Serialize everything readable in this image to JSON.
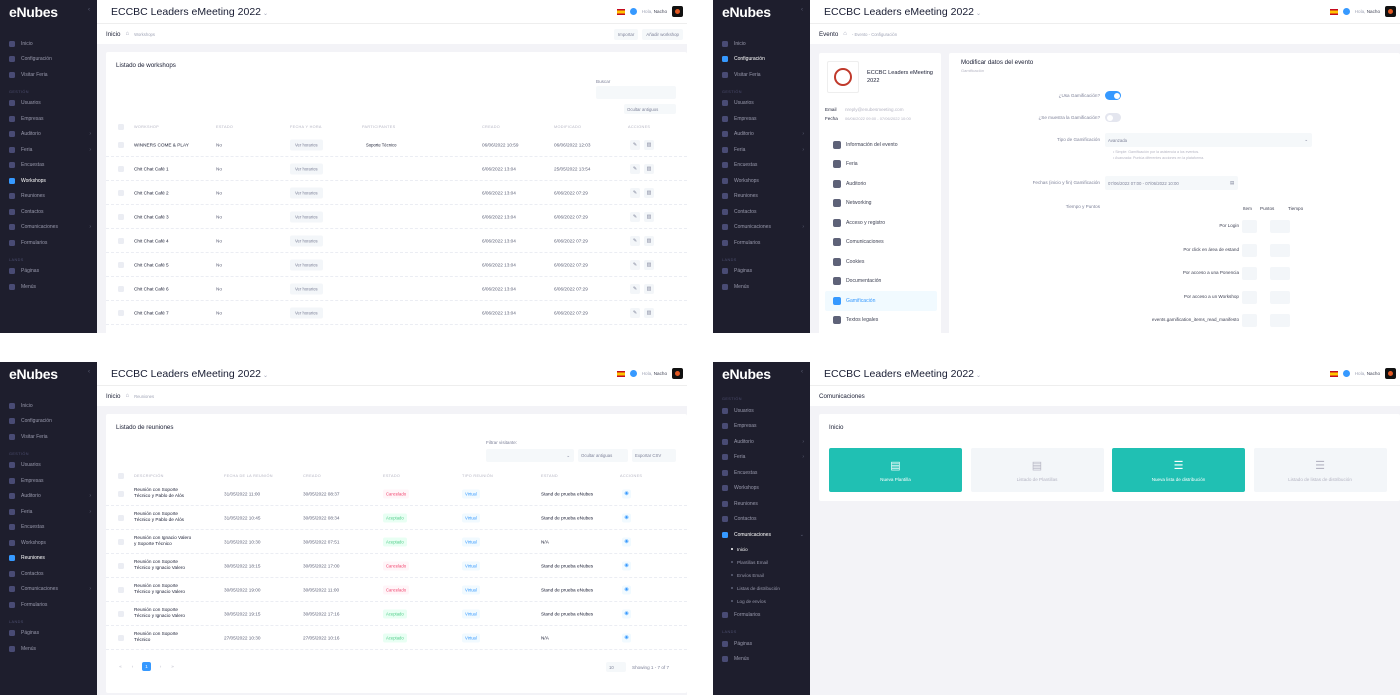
{
  "app": {
    "logo": "eNubes",
    "event_title": "ECCBC Leaders eMeeting 2022",
    "greeting": "Hola,",
    "user": "Nacho"
  },
  "colors": {
    "sidebar": "#1e1e2d",
    "accent": "#3699ff",
    "teal": "#20c0b3",
    "danger": "#f1416c",
    "success": "#50cd89"
  },
  "panel1": {
    "sidebar": [
      {
        "label": "Inicio",
        "section": ""
      },
      {
        "label": "Configuración",
        "section": ""
      },
      {
        "label": "Visitar Feria",
        "section": ""
      },
      {
        "label": "Usuarios",
        "section": "GESTIÓN"
      },
      {
        "label": "Empresas",
        "section": ""
      },
      {
        "label": "Auditorio",
        "section": "",
        "arrow": true
      },
      {
        "label": "Feria",
        "section": "",
        "arrow": true
      },
      {
        "label": "Encuestas",
        "section": ""
      },
      {
        "label": "Workshops",
        "section": "",
        "active": true
      },
      {
        "label": "Reuniones",
        "section": ""
      },
      {
        "label": "Contactos",
        "section": ""
      },
      {
        "label": "Comunicaciones",
        "section": "",
        "arrow": true
      },
      {
        "label": "Formularios",
        "section": ""
      },
      {
        "label": "Páginas",
        "section": "LANDS"
      },
      {
        "label": "Menús",
        "section": ""
      }
    ],
    "page_title": "Inicio",
    "breadcrumb": "Workshops",
    "btn_import": "Importar",
    "btn_add": "Añadir workshop",
    "card_title": "Listado de workshops",
    "search_label": "Buscar",
    "hide_old": "Ocultar antiguos",
    "headers": [
      "WORKSHOP",
      "ESTADO",
      "FECHA Y HORA",
      "PARTICIPANTES",
      "CREADO",
      "MODIFICADO",
      "ACCIONES"
    ],
    "view_schedule": "Ver horarios",
    "rows": [
      {
        "name": "WINNERS COME & PLAY",
        "status": "No",
        "participants": "Soporte Técnico",
        "created": "06/06/2022 10:59",
        "modified": "06/06/2022 12:03"
      },
      {
        "name": "Chit Chat Café 1",
        "status": "No",
        "participants": "",
        "created": "6/06/2022 13:04",
        "modified": "25/05/2022 13:54"
      },
      {
        "name": "Chit Chat Café 2",
        "status": "No",
        "participants": "",
        "created": "6/06/2022 13:04",
        "modified": "6/06/2022 07:29"
      },
      {
        "name": "Chit Chat Café 3",
        "status": "No",
        "participants": "",
        "created": "6/06/2022 13:04",
        "modified": "6/06/2022 07:29"
      },
      {
        "name": "Chit Chat Café 4",
        "status": "No",
        "participants": "",
        "created": "6/06/2022 13:04",
        "modified": "6/06/2022 07:29"
      },
      {
        "name": "Chit Chat Café 5",
        "status": "No",
        "participants": "",
        "created": "6/06/2022 13:04",
        "modified": "6/06/2022 07:29"
      },
      {
        "name": "Chit Chat Café 6",
        "status": "No",
        "participants": "",
        "created": "6/06/2022 13:04",
        "modified": "6/06/2022 07:29"
      },
      {
        "name": "Chit Chat Café 7",
        "status": "No",
        "participants": "",
        "created": "6/06/2022 13:04",
        "modified": "6/06/2022 07:29"
      }
    ]
  },
  "panel2": {
    "sidebar": [
      {
        "label": "Inicio",
        "section": ""
      },
      {
        "label": "Configuración",
        "section": "",
        "active": true
      },
      {
        "label": "Visitar Feria",
        "section": ""
      },
      {
        "label": "Usuarios",
        "section": "GESTIÓN"
      },
      {
        "label": "Empresas",
        "section": ""
      },
      {
        "label": "Auditorio",
        "section": "",
        "arrow": true
      },
      {
        "label": "Feria",
        "section": "",
        "arrow": true
      },
      {
        "label": "Encuestas",
        "section": ""
      },
      {
        "label": "Workshops",
        "section": ""
      },
      {
        "label": "Reuniones",
        "section": ""
      },
      {
        "label": "Contactos",
        "section": ""
      },
      {
        "label": "Comunicaciones",
        "section": "",
        "arrow": true
      },
      {
        "label": "Formularios",
        "section": ""
      },
      {
        "label": "Páginas",
        "section": "LANDS"
      },
      {
        "label": "Menús",
        "section": ""
      }
    ],
    "page_title": "Evento",
    "breadcrumb": "- Evento - Configuración",
    "event_name": "ECCBC Leaders eMeeting 2022",
    "email_label": "Email",
    "email_value": "nreply@enubesmeeting.com",
    "date_label": "Fecha",
    "date_value": "06/06/2022 09:00 - 07/06/2022 10:00",
    "nav": [
      {
        "label": "Información del evento"
      },
      {
        "label": "Feria"
      },
      {
        "label": "Auditorio"
      },
      {
        "label": "Networking"
      },
      {
        "label": "Acceso y registro"
      },
      {
        "label": "Comunicaciones"
      },
      {
        "label": "Cookies"
      },
      {
        "label": "Documentación"
      },
      {
        "label": "Gamificación",
        "active": true
      },
      {
        "label": "Textos legales"
      }
    ],
    "form_title": "Modificar datos del evento",
    "form_subtitle": "Gamificación",
    "q_use": "¿Usa Gamificación?",
    "q_show": "¿Se muestra la Gamificación?",
    "type_label": "Tipo de Gamificación",
    "type_value": "Avanzada",
    "type_help1": "• Simple: Gamificación por la asistencia a los eventos.",
    "type_help2": "• Avanzada: Puntúa diferentes acciones en la plataforma.",
    "dates_label": "Fechas (inicio y fin) Gamificación",
    "dates_value": "07/06/2022 07:00 - 07/06/2022 10:00",
    "tp_label": "Tiempo y Puntos",
    "col_item": "Item",
    "col_points": "Puntos",
    "col_time": "Tiempo",
    "items": [
      "Por Login",
      "Por click en área de estand",
      "Por acceso a una Ponencia",
      "Por acceso a un Workshop",
      "events.gamification_items_read_manifesto"
    ]
  },
  "panel3": {
    "sidebar": [
      {
        "label": "Inicio",
        "section": ""
      },
      {
        "label": "Configuración",
        "section": ""
      },
      {
        "label": "Visitar Feria",
        "section": ""
      },
      {
        "label": "Usuarios",
        "section": "GESTIÓN"
      },
      {
        "label": "Empresas",
        "section": ""
      },
      {
        "label": "Auditorio",
        "section": "",
        "arrow": true
      },
      {
        "label": "Feria",
        "section": "",
        "arrow": true
      },
      {
        "label": "Encuestas",
        "section": ""
      },
      {
        "label": "Workshops",
        "section": ""
      },
      {
        "label": "Reuniones",
        "section": "",
        "active": true
      },
      {
        "label": "Contactos",
        "section": ""
      },
      {
        "label": "Comunicaciones",
        "section": "",
        "arrow": true
      },
      {
        "label": "Formularios",
        "section": ""
      },
      {
        "label": "Páginas",
        "section": "LANDS"
      },
      {
        "label": "Menús",
        "section": ""
      }
    ],
    "page_title": "Inicio",
    "breadcrumb": "Reuniones",
    "card_title": "Listado de reuniones",
    "filter_label": "Filtrar visitante:",
    "hide_old": "Ocultar antiguas",
    "export": "Exportar CSV",
    "headers": [
      "DESCRIPCIÓN",
      "FECHA DE LA REUNIÓN",
      "CREADO",
      "ESTADO",
      "TIPO REUNIÓN",
      "ESTAND",
      "ACCIONES"
    ],
    "rows": [
      {
        "l1": "Reunión con Soporte",
        "l2": "Técnico y Pablo de Alós",
        "date": "31/05/2022 11:00",
        "created": "30/05/2022 08:37",
        "status": "Cancelado",
        "sc": "red",
        "type": "Virtual",
        "stand": "Stand de prueba eNubes"
      },
      {
        "l1": "Reunión con Soporte",
        "l2": "Técnico y Pablo de Alós",
        "date": "31/05/2022 10:45",
        "created": "30/05/2022 08:34",
        "status": "Aceptado",
        "sc": "grn",
        "type": "Virtual",
        "stand": "Stand de prueba eNubes"
      },
      {
        "l1": "Reunión con Ignacio Valero",
        "l2": "y Soporte Técnico",
        "date": "31/05/2022 10:30",
        "created": "30/05/2022 07:51",
        "status": "Aceptado",
        "sc": "grn",
        "type": "Virtual",
        "stand": "N/A"
      },
      {
        "l1": "Reunión con Soporte",
        "l2": "Técnico y Ignacio Valero",
        "date": "30/05/2022 18:15",
        "created": "30/05/2022 17:00",
        "status": "Cancelado",
        "sc": "red",
        "type": "Virtual",
        "stand": "Stand de prueba eNubes"
      },
      {
        "l1": "Reunión con Soporte",
        "l2": "Técnico y Ignacio Valero",
        "date": "30/05/2022 19:00",
        "created": "30/05/2022 11:00",
        "status": "Cancelado",
        "sc": "red",
        "type": "Virtual",
        "stand": "Stand de prueba eNubes"
      },
      {
        "l1": "Reunión con Soporte",
        "l2": "Técnico y Ignacio Valero",
        "date": "30/05/2022 19:15",
        "created": "30/05/2022 17:16",
        "status": "Aceptado",
        "sc": "grn",
        "type": "Virtual",
        "stand": "Stand de prueba eNubes"
      },
      {
        "l1": "Reunión con Soporte",
        "l2": "Técnico",
        "date": "27/05/2022 10:30",
        "created": "27/05/2022 10:16",
        "status": "Aceptado",
        "sc": "grn",
        "type": "Virtual",
        "stand": "N/A"
      }
    ],
    "page_current": "1",
    "page_size": "10",
    "showing": "Showing 1 - 7 of 7"
  },
  "panel4": {
    "sidebar": [
      {
        "label": "Usuarios",
        "section": "GESTIÓN"
      },
      {
        "label": "Empresas",
        "section": ""
      },
      {
        "label": "Auditorio",
        "section": "",
        "arrow": true
      },
      {
        "label": "Feria",
        "section": "",
        "arrow": true
      },
      {
        "label": "Encuestas",
        "section": ""
      },
      {
        "label": "Workshops",
        "section": ""
      },
      {
        "label": "Reuniones",
        "section": ""
      },
      {
        "label": "Contactos",
        "section": ""
      },
      {
        "label": "Comunicaciones",
        "section": "",
        "active": true,
        "arrow": true
      }
    ],
    "sub": [
      {
        "label": "Inicio",
        "active": true
      },
      {
        "label": "Plantillas Email"
      },
      {
        "label": "Envíos Email"
      },
      {
        "label": "Listas de distribución"
      },
      {
        "label": "Log de envíos"
      }
    ],
    "sidebar_after": [
      {
        "label": "Formularios",
        "section": ""
      },
      {
        "label": "Páginas",
        "section": "LANDS"
      },
      {
        "label": "Menús",
        "section": ""
      }
    ],
    "page_title": "Comunicaciones",
    "card_title": "Inicio",
    "tiles": [
      {
        "label": "Nueva Plantilla",
        "style": "teal",
        "icon": "document-icon"
      },
      {
        "label": "Listado de Plantillas",
        "style": "grey",
        "icon": "document-icon"
      },
      {
        "label": "Nueva lista de distribución",
        "style": "teal",
        "icon": "list-icon"
      },
      {
        "label": "Listado de listas de distribución",
        "style": "grey",
        "icon": "list-icon"
      }
    ]
  }
}
